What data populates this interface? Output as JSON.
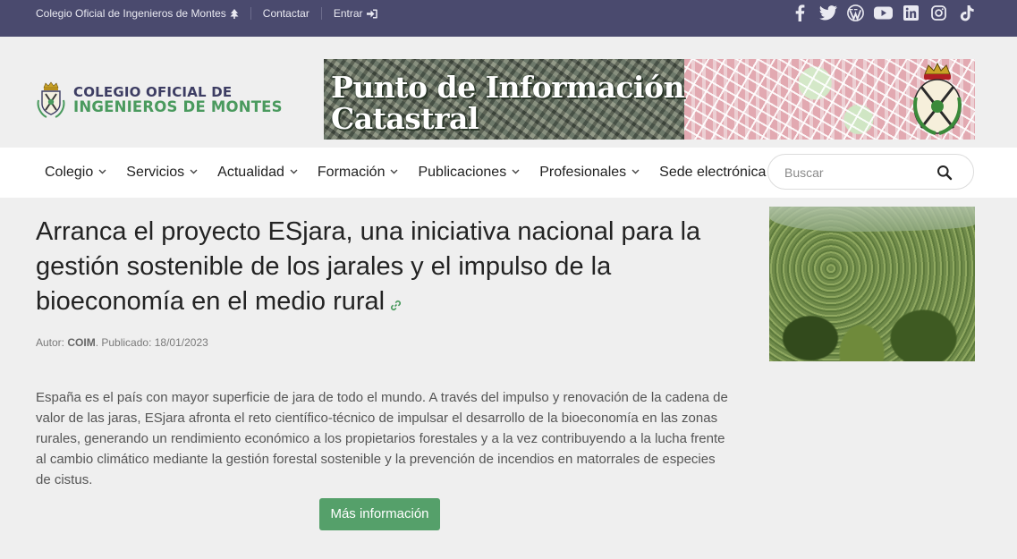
{
  "topbar": {
    "org_link": "Colegio Oficial de Ingenieros de Montes",
    "contact": "Contactar",
    "login": "Entrar",
    "social": [
      "facebook-icon",
      "twitter-icon",
      "wordpress-icon",
      "youtube-icon",
      "linkedin-icon",
      "instagram-icon",
      "tiktok-icon"
    ]
  },
  "header": {
    "logo_line1": "COLEGIO OFICIAL DE",
    "logo_line2": "INGENIEROS DE MONTES",
    "banner_line1": "Punto de Información",
    "banner_line2": "Catastral"
  },
  "nav": {
    "items": [
      {
        "label": "Colegio",
        "dropdown": true
      },
      {
        "label": "Servicios",
        "dropdown": true
      },
      {
        "label": "Actualidad",
        "dropdown": true
      },
      {
        "label": "Formación",
        "dropdown": true
      },
      {
        "label": "Publicaciones",
        "dropdown": true
      },
      {
        "label": "Profesionales",
        "dropdown": true
      },
      {
        "label": "Sede electrónica",
        "dropdown": false
      }
    ],
    "search_placeholder": "Buscar"
  },
  "article": {
    "title": "Arranca el proyecto ESjara, una iniciativa nacional para la gestión sostenible de los jarales y el impulso de la bioeconomía en el medio rural",
    "author_label": "Autor: ",
    "author": "COIM",
    "published": ". Publicado: 18/01/2023",
    "body": "España es el país con mayor superficie de jara de todo el mundo. A través del impulso y renovación de la cadena de valor de las jaras, ESjara afronta el reto científico-técnico de impulsar el desarrollo de la bioeconomía en las zonas rurales, generando un rendimiento económico a los propietarios forestales y a la vez contribuyendo a la lucha frente al cambio climático mediante la gestión forestal sostenible y la prevención de incendios en matorrales de especies de cistus.",
    "button": "Más información"
  },
  "colors": {
    "topbar": "#4a4a6e",
    "brand_green": "#4a9a5e",
    "brand_navy": "#3d3d63",
    "button": "#55a06a"
  }
}
